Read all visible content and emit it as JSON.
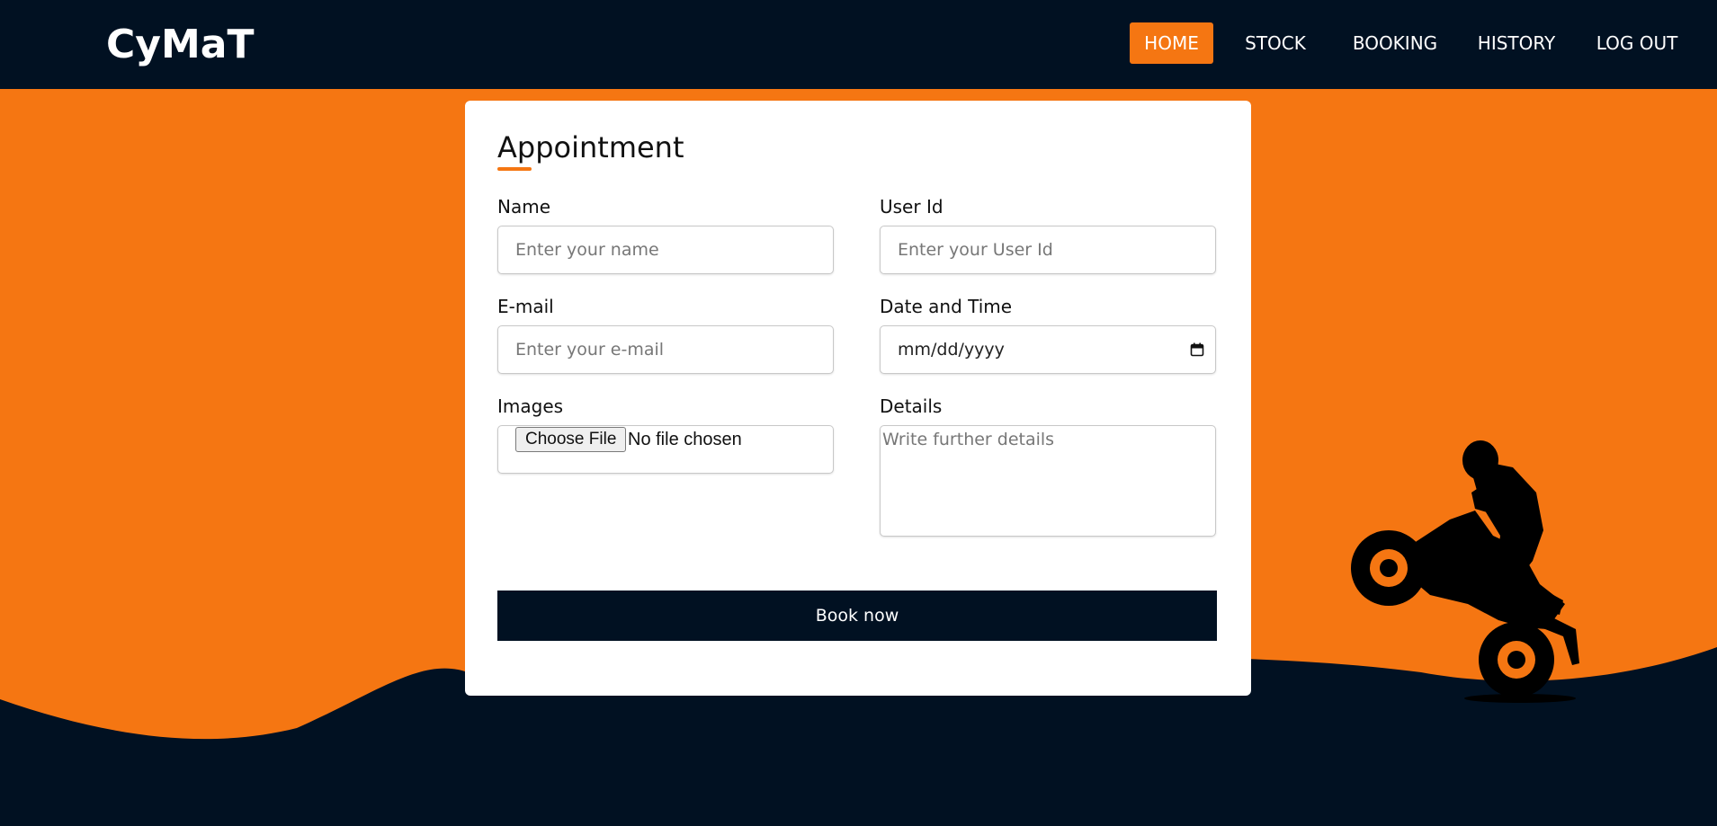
{
  "brand": {
    "logo": "CyMaT"
  },
  "nav": {
    "items": [
      {
        "label": "HOME",
        "active": true
      },
      {
        "label": "STOCK",
        "active": false
      },
      {
        "label": "BOOKING",
        "active": false
      },
      {
        "label": "HISTORY",
        "active": false
      },
      {
        "label": "LOG OUT",
        "active": false
      }
    ]
  },
  "form": {
    "title": "Appointment",
    "name": {
      "label": "Name",
      "placeholder": "Enter your name"
    },
    "user_id": {
      "label": "User Id",
      "placeholder": "Enter your User Id"
    },
    "email": {
      "label": "E-mail",
      "placeholder": "Enter your e-mail"
    },
    "datetime": {
      "label": "Date and Time",
      "value": "mm/dd/yyyy"
    },
    "images": {
      "label": "Images",
      "button": "Choose File",
      "status": "No file chosen"
    },
    "details": {
      "label": "Details",
      "placeholder": "Write further details"
    },
    "submit": "Book now"
  },
  "colors": {
    "accent": "#f57612",
    "dark": "#011122",
    "card": "#ffffff"
  },
  "icons": {
    "date": "calendar-icon",
    "hero": "motorcycle-rider-silhouette"
  }
}
